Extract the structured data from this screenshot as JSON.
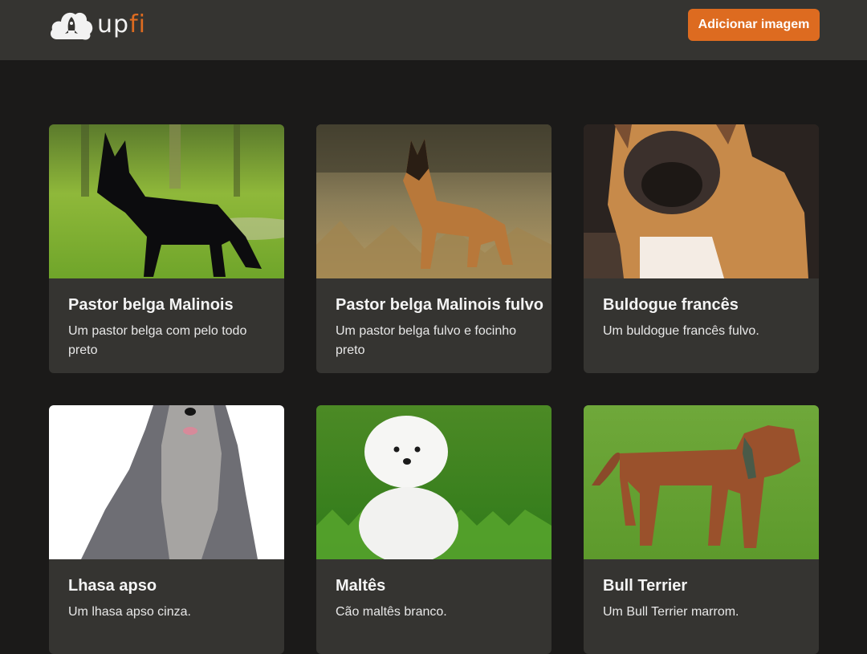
{
  "header": {
    "logo": {
      "up": "up",
      "fi": "fi"
    },
    "add_button_label": "Adicionar imagem"
  },
  "cards": [
    {
      "title": "Pastor belga Malinois",
      "description": "Um pastor belga com pelo todo preto"
    },
    {
      "title": "Pastor belga Malinois fulvo",
      "description": "Um pastor belga fulvo e focinho preto"
    },
    {
      "title": "Buldogue francês",
      "description": "Um buldogue francês fulvo."
    },
    {
      "title": "Lhasa apso",
      "description": "Um lhasa apso cinza."
    },
    {
      "title": "Maltês",
      "description": "Cão maltês branco."
    },
    {
      "title": "Bull Terrier",
      "description": "Um Bull Terrier marrom."
    }
  ],
  "colors": {
    "accent": "#dd6b20",
    "background": "#1b1a19",
    "card": "#353431"
  }
}
